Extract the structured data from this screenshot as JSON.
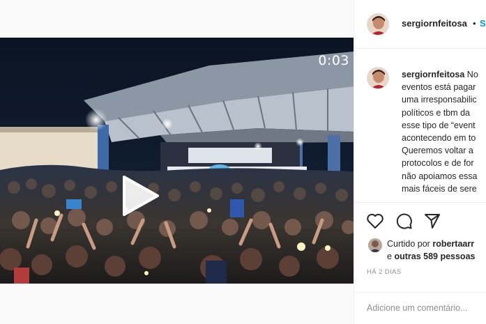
{
  "video": {
    "timer": "0:03"
  },
  "post": {
    "username": "sergiornfeitosa",
    "header_separator": "•",
    "header_follow": "S",
    "caption_lines": [
      "No",
      "eventos está pagar",
      "uma irresponsabilic",
      "políticos e tbm da",
      "esse tipo de “event",
      "acontecendo em to",
      "Queremos voltar a",
      "protocolos e de for",
      "não apoiamos essa",
      "mais fáceis de sere"
    ]
  },
  "engagement": {
    "liked_prefix": "Curtido por",
    "liked_user": "robertaarr",
    "liked_and": "e",
    "liked_others": "outras 589 pessoas",
    "time_ago": "HÁ 2 DIAS"
  },
  "comment": {
    "placeholder": "Adicione um comentário..."
  },
  "icons": [
    "play-icon",
    "heart-icon",
    "comment-icon",
    "share-icon"
  ],
  "colors": {
    "link_blue": "#0095f6",
    "muted": "#8e8e8e",
    "text": "#262626"
  }
}
